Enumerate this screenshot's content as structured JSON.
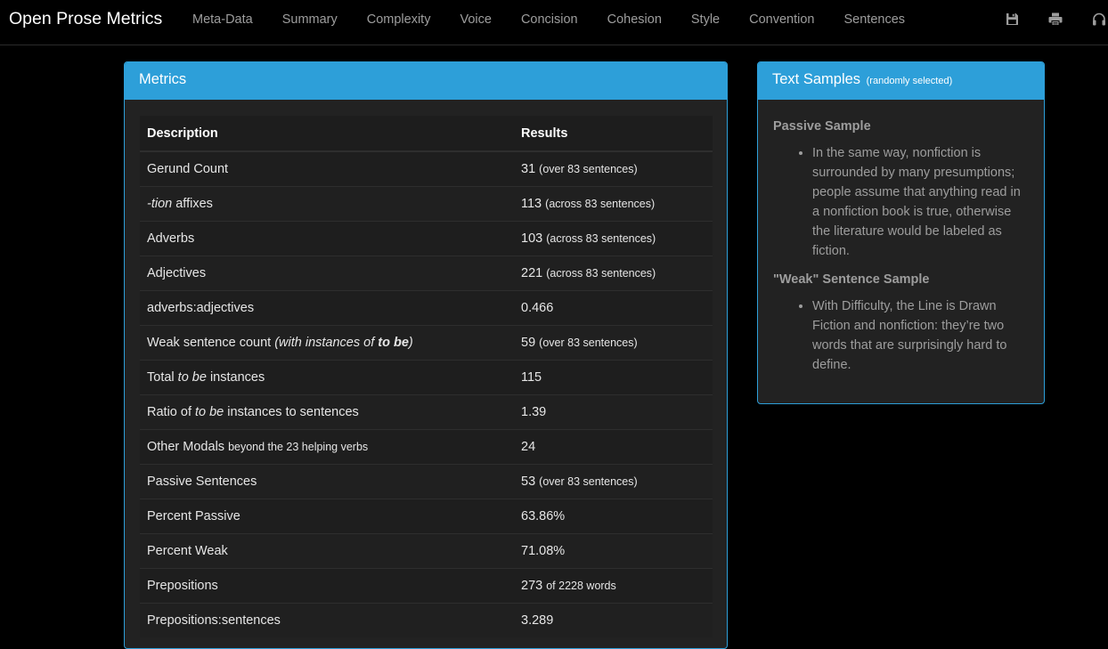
{
  "app": {
    "title": "Open Prose Metrics"
  },
  "nav": {
    "items": [
      "Meta-Data",
      "Summary",
      "Complexity",
      "Voice",
      "Concision",
      "Cohesion",
      "Style",
      "Convention",
      "Sentences"
    ],
    "icons": [
      "save-icon",
      "print-icon",
      "headphones-icon"
    ]
  },
  "metrics": {
    "title": "Metrics",
    "headers": {
      "description": "Description",
      "results": "Results"
    },
    "rows": [
      {
        "desc": "Gerund Count",
        "value": "31",
        "note": "(over 83 sentences)"
      },
      {
        "desc_em": "-tion",
        "desc": " affixes",
        "value": "113",
        "note": "(across 83 sentences)"
      },
      {
        "desc": "Adverbs",
        "value": "103",
        "note": "(across 83 sentences)"
      },
      {
        "desc": "Adjectives",
        "value": "221",
        "note": "(across 83 sentences)"
      },
      {
        "desc": "adverbs:adjectives",
        "value": "0.466"
      },
      {
        "desc": "Weak sentence count ",
        "desc_em2": "(with instances of ",
        "desc_bi": "to be",
        "desc_em3": ")",
        "value": "59",
        "note": "(over 83 sentences)"
      },
      {
        "desc": "Total ",
        "desc_em": "to be",
        "desc_after": " instances",
        "value": "115"
      },
      {
        "desc": "Ratio of ",
        "desc_em": "to be",
        "desc_after": " instances to sentences",
        "value": "1.39"
      },
      {
        "desc": "Other Modals ",
        "desc_small": "beyond the 23 helping verbs",
        "value": "24"
      },
      {
        "desc": "Passive Sentences",
        "value": "53",
        "note": "(over 83 sentences)"
      },
      {
        "desc": "Percent Passive",
        "value": "63.86%"
      },
      {
        "desc": "Percent Weak",
        "value": "71.08%"
      },
      {
        "desc": "Prepositions",
        "value": "273",
        "note": "of 2228 words"
      },
      {
        "desc": "Prepositions:sentences",
        "value": "3.289"
      }
    ]
  },
  "samples": {
    "title": "Text Samples",
    "subtitle": "(randomly selected)",
    "passive_title": "Passive Sample",
    "passive_text": "In the same way, nonfiction is surrounded by many presumptions; people assume that anything read in a nonfiction book is true, otherwise the literature would be labeled as fiction.",
    "weak_title": "\"Weak\" Sentence Sample",
    "weak_text": "With Difficulty, the Line is Drawn Fiction and nonfiction: they’re two words that are surprisingly hard to define."
  },
  "colors": {
    "accent": "#2d9fd9",
    "background": "#000000",
    "panel": "#222222",
    "muted_text": "#9d9d9d"
  }
}
